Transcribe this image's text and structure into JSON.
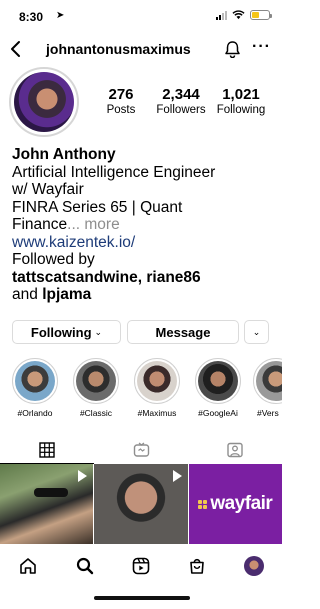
{
  "status_bar": {
    "time": "8:30",
    "location_glyph": "➤"
  },
  "header": {
    "username": "johnantonusmaximus",
    "more_glyph": "···"
  },
  "stats": [
    {
      "value": "276",
      "label": "Posts"
    },
    {
      "value": "2,344",
      "label": "Followers"
    },
    {
      "value": "1,021",
      "label": "Following"
    }
  ],
  "bio": {
    "name": "John Anthony",
    "line1": "Artificial Intelligence Engineer",
    "line2": "w/ Wayfair",
    "line3": "FINRA Series 65 | Quant",
    "line4_text": "Finance",
    "line4_more": "... more",
    "link": "www.kaizentek.io/",
    "followed_by_prefix": "Followed by",
    "followed_by_names": "tattscatsandwine, riane86",
    "followed_by_and": "and",
    "followed_by_last": "lpjama"
  },
  "buttons": {
    "following": "Following",
    "message": "Message",
    "chevron": "⌄"
  },
  "highlights": [
    {
      "caption": "#Orlando"
    },
    {
      "caption": "#Classic"
    },
    {
      "caption": "#Maximus"
    },
    {
      "caption": "#GoogleAi"
    },
    {
      "caption": "#Vers"
    }
  ],
  "grid": {
    "wayfair_text": "wayfair"
  },
  "colors": {
    "link": "#1d3b78",
    "wayfair_bg": "#7b1fa2",
    "battery": "#f5c518",
    "divider": "#dbdbdb"
  },
  "icons": {
    "tabs": [
      "grid-icon",
      "reels-tab-icon",
      "tagged-icon"
    ],
    "nav": [
      "home-icon",
      "search-icon",
      "reels-icon",
      "shop-icon",
      "profile-avatar"
    ]
  }
}
